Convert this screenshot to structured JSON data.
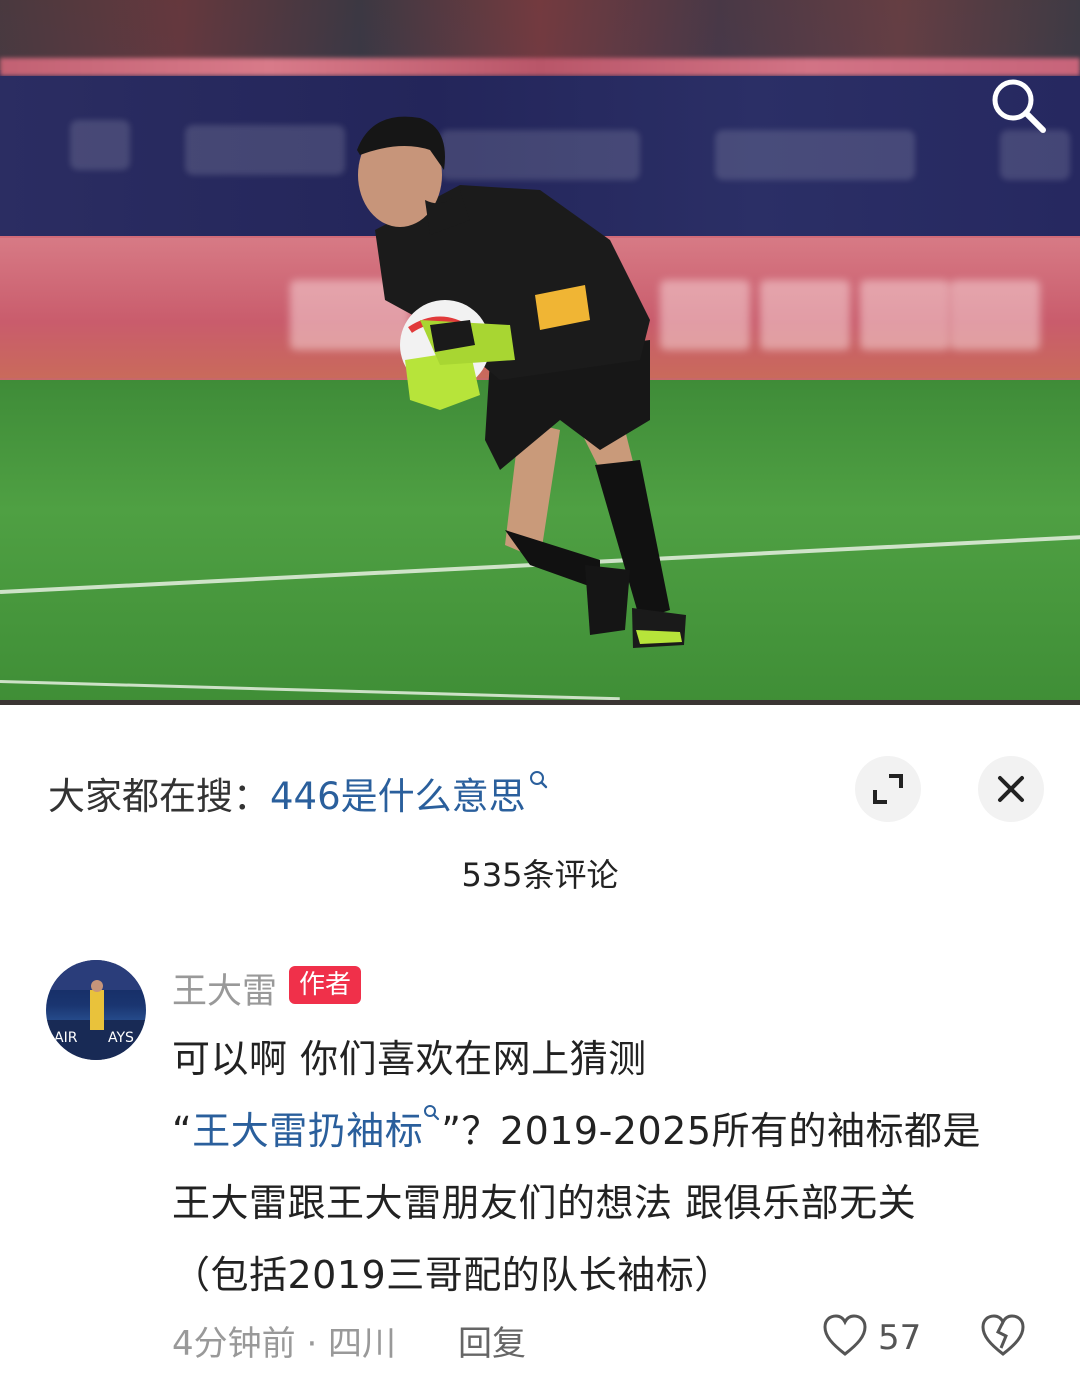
{
  "photo": {
    "alt": ""
  },
  "hot_search": {
    "prefix": "大家都在搜：",
    "keyword": "446是什么意思"
  },
  "comments_header": {
    "count_label": "535条评论"
  },
  "comment": {
    "author": "王大雷",
    "author_badge": "作者",
    "line1": "可以啊 你们喜欢在网上猜测",
    "quote_open": "“",
    "link_text": "王大雷扔袖标",
    "line2_rest": "”？2019-2025所有的袖标都是",
    "line3": "王大雷跟王大雷朋友们的想法 跟俱乐部无关",
    "line4": "（包括2019三哥配的队长袖标）",
    "time_location": "4分钟前 · 四川",
    "reply_label": "回复",
    "like_count": "57"
  },
  "colors": {
    "link": "#2a5f9c",
    "badge": "#f0304a",
    "muted": "#999999"
  },
  "icons": [
    "search-icon",
    "expand-icon",
    "close-icon",
    "heart-icon",
    "heart-broken-icon",
    "search-mini-icon"
  ]
}
